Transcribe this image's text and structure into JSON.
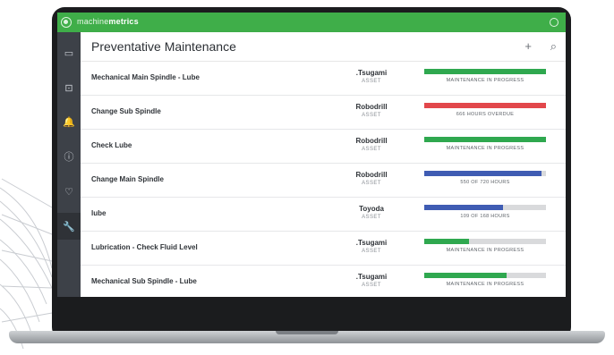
{
  "app": {
    "brand_light": "machine",
    "brand_bold": "metrics",
    "accent": "#3fae49"
  },
  "header": {
    "title": "Preventative Maintenance",
    "add_icon": "+",
    "search_icon": "⌕"
  },
  "sidebar": {
    "items": [
      {
        "name": "wallet",
        "glyph": "▭"
      },
      {
        "name": "chart",
        "glyph": "⊡"
      },
      {
        "name": "bell",
        "glyph": "🔔"
      },
      {
        "name": "alert",
        "glyph": "ⓘ"
      },
      {
        "name": "heartbeat",
        "glyph": "♡"
      },
      {
        "name": "wrench",
        "glyph": "🔧"
      }
    ]
  },
  "tasks": [
    {
      "task": "Mechanical Main Spindle - Lube",
      "asset": ".Tsugami",
      "asset_label": "ASSET",
      "status": "MAINTENANCE IN PROGRESS",
      "progress": 1.0,
      "color": "#2fa84f"
    },
    {
      "task": "Change Sub Spindle",
      "asset": "Robodrill",
      "asset_label": "ASSET",
      "status": "666 HOURS OVERDUE",
      "progress": 1.0,
      "color": "#e2474b"
    },
    {
      "task": "Check Lube",
      "asset": "Robodrill",
      "asset_label": "ASSET",
      "status": "MAINTENANCE IN PROGRESS",
      "progress": 1.0,
      "color": "#2fa84f"
    },
    {
      "task": "Change Main Spindle",
      "asset": "Robodrill",
      "asset_label": "ASSET",
      "status": "550 OF 720 HOURS",
      "progress": 0.96,
      "color": "#3f5cb3"
    },
    {
      "task": "lube",
      "asset": "Toyoda",
      "asset_label": "ASSET",
      "status": "109 OF 168 HOURS",
      "progress": 0.65,
      "color": "#3f5cb3"
    },
    {
      "task": "Lubrication - Check Fluid Level",
      "asset": ".Tsugami",
      "asset_label": "ASSET",
      "status": "MAINTENANCE IN PROGRESS",
      "progress": 0.37,
      "color": "#2fa84f"
    },
    {
      "task": "Mechanical Sub Spindle - Lube",
      "asset": ".Tsugami",
      "asset_label": "ASSET",
      "status": "MAINTENANCE IN PROGRESS",
      "progress": 0.68,
      "color": "#2fa84f"
    }
  ]
}
